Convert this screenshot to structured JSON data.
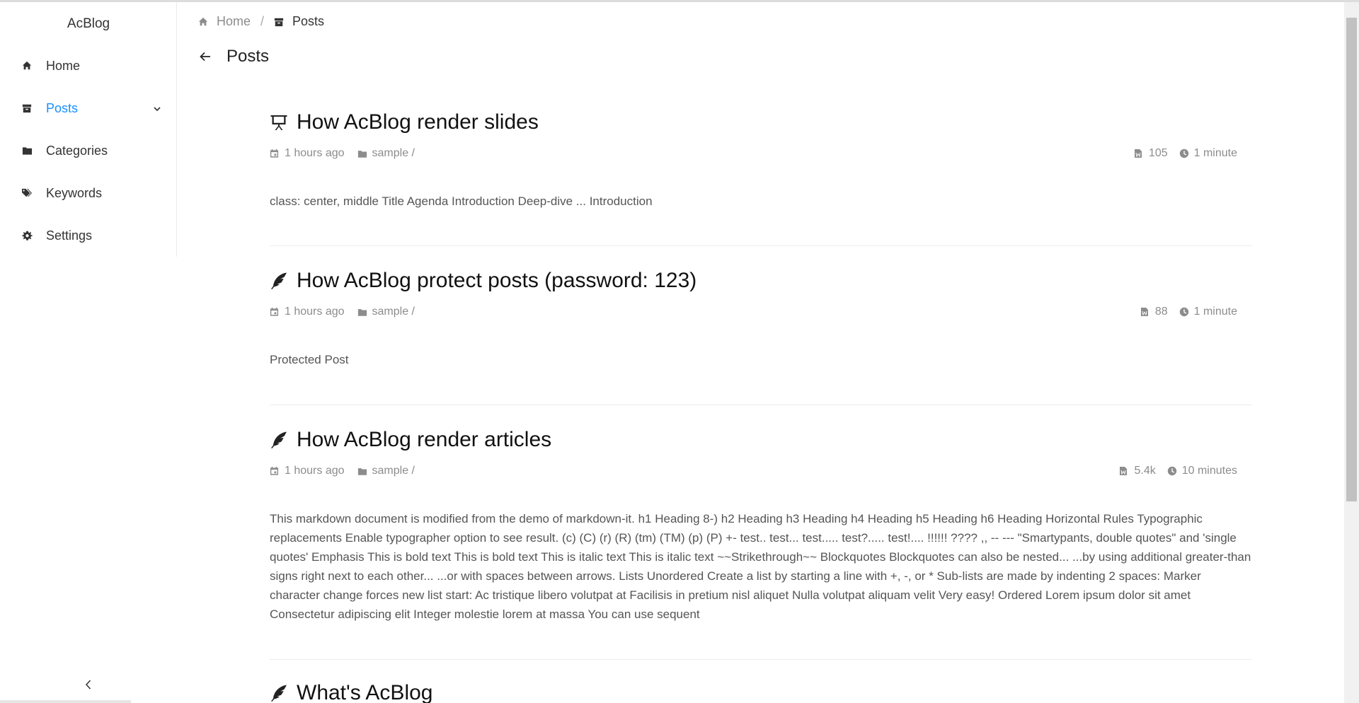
{
  "app": {
    "brand": "AcBlog"
  },
  "sidebar": {
    "items": [
      {
        "label": "Home",
        "icon": "home-icon"
      },
      {
        "label": "Posts",
        "icon": "archive-icon",
        "active": true
      },
      {
        "label": "Categories",
        "icon": "folder-icon"
      },
      {
        "label": "Keywords",
        "icon": "tags-icon"
      },
      {
        "label": "Settings",
        "icon": "gear-icon"
      }
    ],
    "collapse_icon": "chevron-left-icon"
  },
  "breadcrumb": {
    "home": "Home",
    "separator": "/",
    "current": "Posts"
  },
  "page": {
    "title": "Posts"
  },
  "colors": {
    "accent": "#1890ff",
    "muted": "#8c8c8c",
    "text": "#222222"
  },
  "posts": [
    {
      "title": "How AcBlog render slides",
      "icon": "presentation-icon",
      "time": "1 hours ago",
      "category": "sample /",
      "words": "105",
      "read_time": "1 minute",
      "summary": "class: center, middle Title Agenda Introduction Deep-dive ... Introduction"
    },
    {
      "title": "How AcBlog protect posts (password: 123)",
      "icon": "feather-icon",
      "time": "1 hours ago",
      "category": "sample /",
      "words": "88",
      "read_time": "1 minute",
      "summary": "Protected Post"
    },
    {
      "title": "How AcBlog render articles",
      "icon": "feather-icon",
      "time": "1 hours ago",
      "category": "sample /",
      "words": "5.4k",
      "read_time": "10 minutes",
      "summary": "This markdown document is modified from the demo of markdown-it. h1 Heading 8-) h2 Heading h3 Heading h4 Heading h5 Heading h6 Heading Horizontal Rules Typographic replacements Enable typographer option to see result. (c) (C) (r) (R) (tm) (TM) (p) (P) +- test.. test... test..... test?..... test!.... !!!!!! ???? ,, -- --- \"Smartypants, double quotes\" and 'single quotes' Emphasis This is bold text This is bold text This is italic text This is italic text ~~Strikethrough~~ Blockquotes Blockquotes can also be nested... ...by using additional greater-than signs right next to each other... ...or with spaces between arrows. Lists Unordered Create a list by starting a line with +, -, or * Sub-lists are made by indenting 2 spaces: Marker character change forces new list start: Ac tristique libero volutpat at Facilisis in pretium nisl aliquet Nulla volutpat aliquam velit Very easy! Ordered Lorem ipsum dolor sit amet Consectetur adipiscing elit Integer molestie lorem at massa You can use sequent"
    },
    {
      "title": "What's AcBlog",
      "icon": "feather-icon"
    }
  ]
}
